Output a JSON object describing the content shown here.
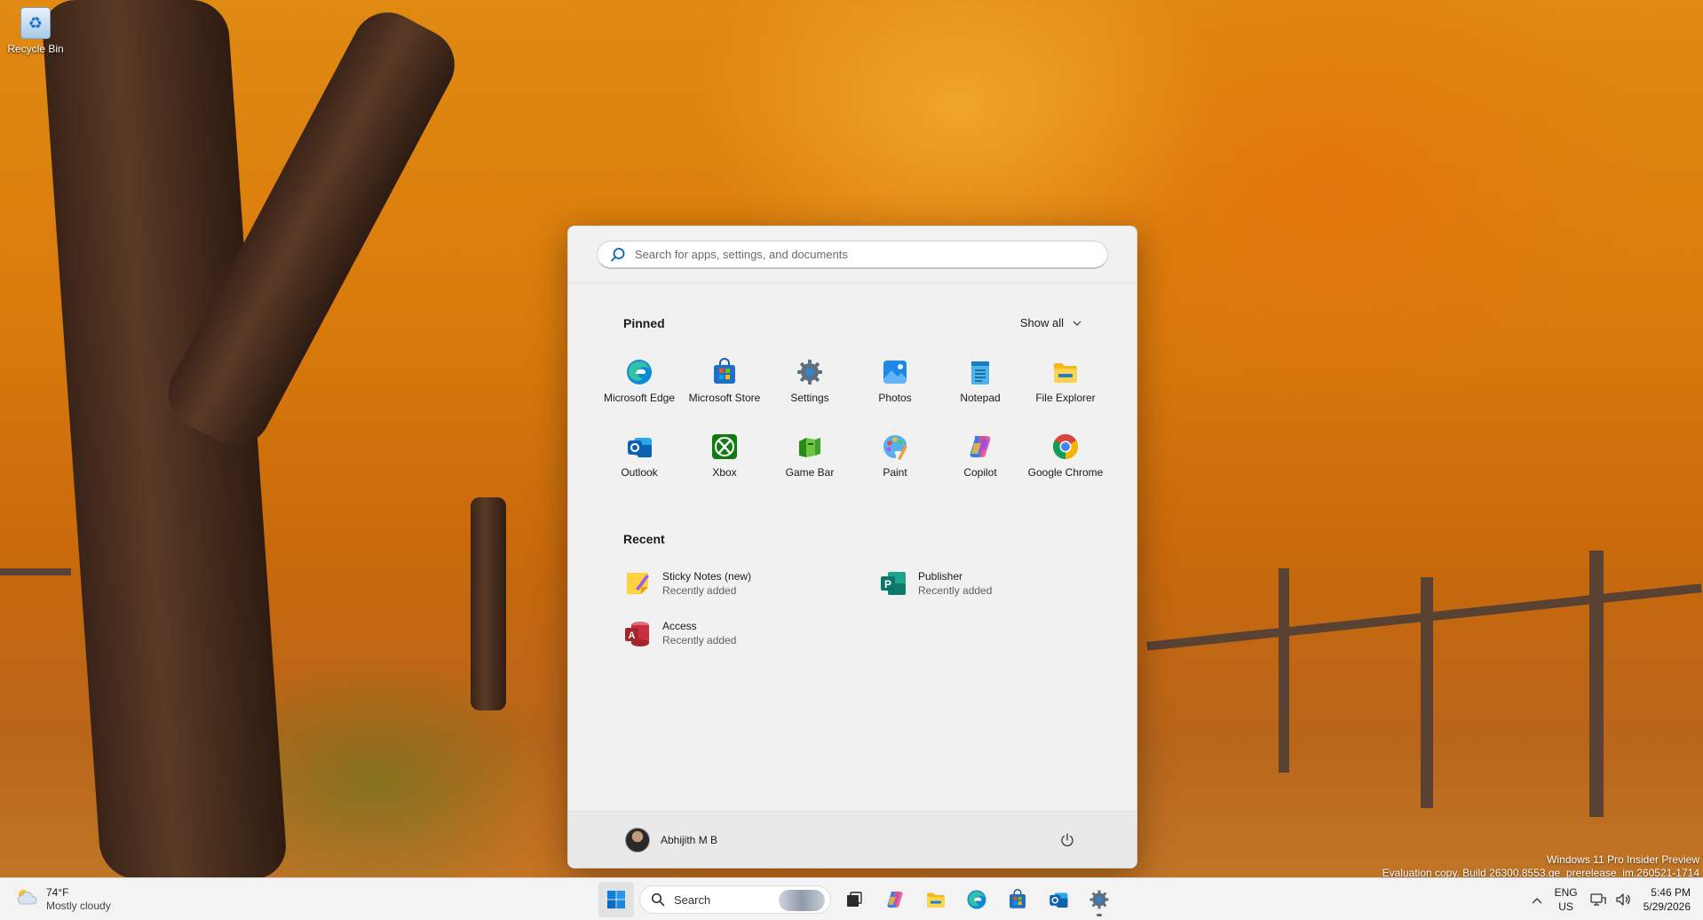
{
  "desktop": {
    "recycle_bin_label": "Recycle Bin",
    "watermark_line1": "Windows 11 Pro Insider Preview",
    "watermark_line2": "Evaluation copy. Build 26300.8553.ge_prerelease_im.260521-1714"
  },
  "start_menu": {
    "search_placeholder": "Search for apps, settings, and documents",
    "pinned_title": "Pinned",
    "show_all_label": "Show all",
    "pinned_apps": [
      {
        "label": "Microsoft Edge",
        "icon": "edge-icon"
      },
      {
        "label": "Microsoft Store",
        "icon": "store-icon"
      },
      {
        "label": "Settings",
        "icon": "settings-icon"
      },
      {
        "label": "Photos",
        "icon": "photos-icon"
      },
      {
        "label": "Notepad",
        "icon": "notepad-icon"
      },
      {
        "label": "File Explorer",
        "icon": "file-explorer-icon"
      },
      {
        "label": "Outlook",
        "icon": "outlook-icon"
      },
      {
        "label": "Xbox",
        "icon": "xbox-icon"
      },
      {
        "label": "Game Bar",
        "icon": "game-bar-icon"
      },
      {
        "label": "Paint",
        "icon": "paint-icon"
      },
      {
        "label": "Copilot",
        "icon": "copilot-icon"
      },
      {
        "label": "Google Chrome",
        "icon": "chrome-icon"
      }
    ],
    "recent_title": "Recent",
    "recent_items": [
      {
        "name": "Sticky Notes (new)",
        "sub": "Recently added",
        "icon": "sticky-notes-icon"
      },
      {
        "name": "Publisher",
        "sub": "Recently added",
        "icon": "publisher-icon"
      },
      {
        "name": "Access",
        "sub": "Recently added",
        "icon": "access-icon"
      }
    ],
    "user_name": "Abhijith M B"
  },
  "taskbar": {
    "weather_temp": "74°F",
    "weather_desc": "Mostly cloudy",
    "search_label": "Search",
    "lang_line1": "ENG",
    "lang_line2": "US",
    "time": "5:46 PM",
    "date": "5/29/2026"
  },
  "colors": {
    "accent": "#0067c0",
    "start_bg": "#f1f1f1",
    "taskbar_bg": "#f3f3f3"
  }
}
